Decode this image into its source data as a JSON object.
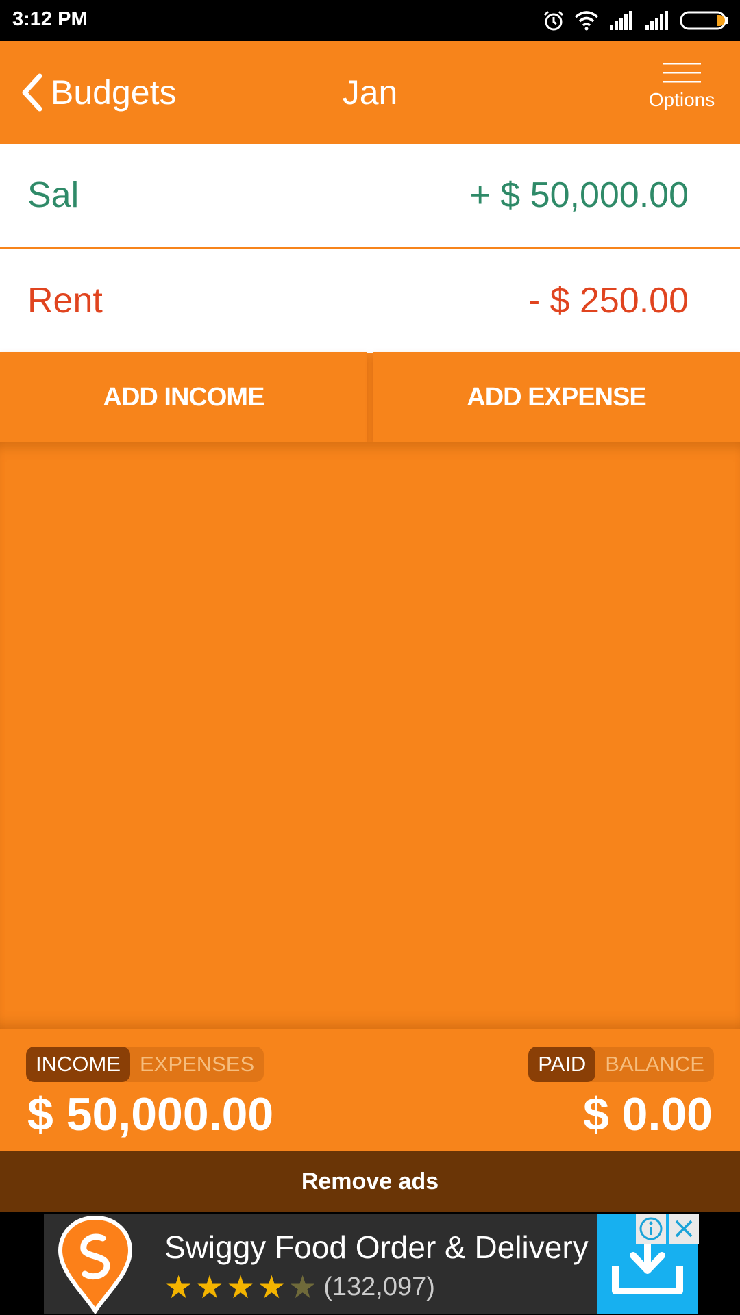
{
  "statusbar": {
    "time": "3:12 PM",
    "icons": [
      "alarm-icon",
      "wifi-icon",
      "signal-icon",
      "signal-icon",
      "battery-icon"
    ]
  },
  "appbar": {
    "back_label": "Budgets",
    "title": "Jan",
    "options_label": "Options"
  },
  "entries": [
    {
      "name": "Sal",
      "amount": "+ $ 50,000.00",
      "type": "income",
      "color": "#2f8a68"
    },
    {
      "name": "Rent",
      "amount": "- $ 250.00",
      "type": "expense",
      "color": "#e0441f"
    }
  ],
  "actions": {
    "add_income": "ADD INCOME",
    "add_expense": "ADD EXPENSE"
  },
  "summary": {
    "left_toggle": {
      "active": "INCOME",
      "inactive": "EXPENSES"
    },
    "left_total": "$ 50,000.00",
    "right_toggle": {
      "active": "PAID",
      "inactive": "BALANCE"
    },
    "right_total": "$ 0.00"
  },
  "remove_ads": "Remove ads",
  "ad": {
    "title": "Swiggy Food Order & Delivery",
    "rating": 4.5,
    "rating_count": "(132,097)",
    "install_color": "#17b0f0"
  },
  "colors": {
    "accent": "#f7841b",
    "income": "#2f8a68",
    "expense": "#e0441f",
    "remove_ads_bg": "#6a3506"
  }
}
